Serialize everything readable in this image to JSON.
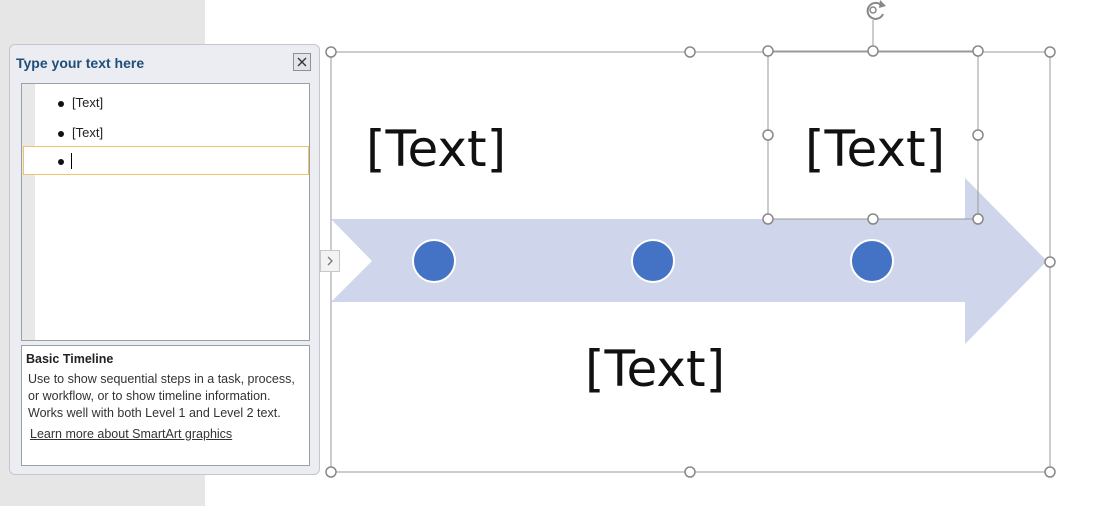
{
  "text_pane": {
    "title": "Type your text here",
    "items": [
      {
        "text": "[Text]"
      },
      {
        "text": "[Text]"
      },
      {
        "text": ""
      }
    ],
    "description": {
      "title": "Basic Timeline",
      "body": "Use to show sequential steps in a task, process, or workflow, or to show timeline information. Works well with both Level 1 and Level 2 text.",
      "link": "Learn more about SmartArt graphics"
    }
  },
  "smartart": {
    "text_1": "[Text]",
    "text_2": "[Text]",
    "text_3": "[Text]",
    "colors": {
      "arrow": "#cfd5ea",
      "dot": "#4472c4",
      "handle": "#888888"
    }
  }
}
